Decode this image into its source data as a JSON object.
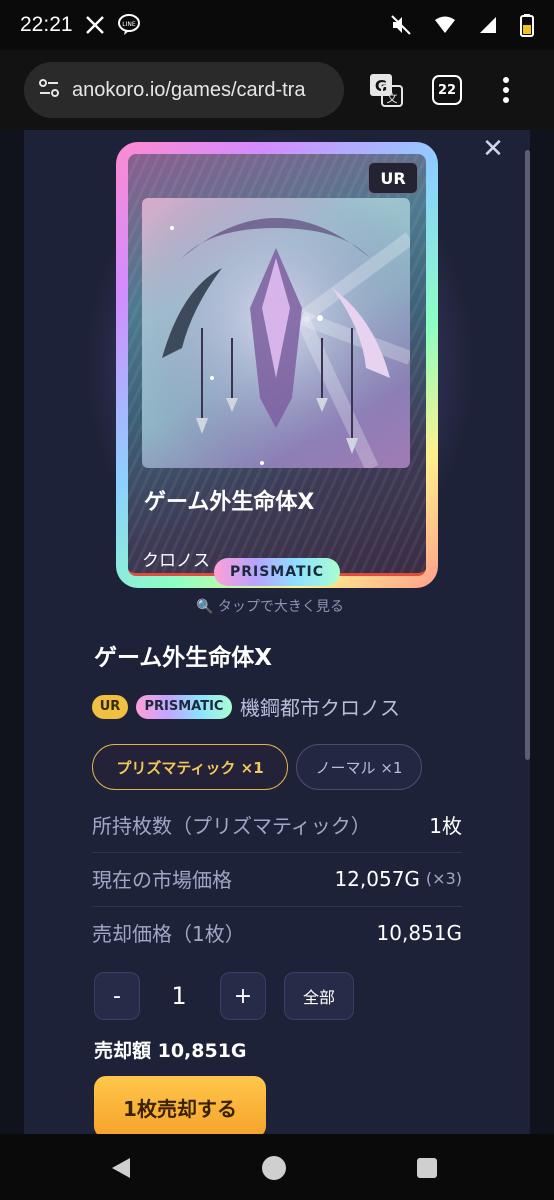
{
  "status_bar": {
    "time": "22:21",
    "icons": [
      "x-icon",
      "line-icon",
      "mute-icon",
      "wifi-icon",
      "signal-icon",
      "battery-icon"
    ]
  },
  "browser": {
    "url": "anokoro.io/games/card-tra",
    "tab_count": "22"
  },
  "card": {
    "rarity": "UR",
    "name": "ゲーム外生命体X",
    "place": "クロノス",
    "finish": "PRISMATIC",
    "tap_hint": "🔍 タップで大きく見る"
  },
  "detail": {
    "title": "ゲーム外生命体X",
    "badge_rarity": "UR",
    "badge_finish": "PRISMATIC",
    "place": "機鋼都市クロノス",
    "variants": [
      {
        "label": "プリズマティック ×1",
        "selected": true
      },
      {
        "label": "ノーマル ×1",
        "selected": false
      }
    ],
    "rows": [
      {
        "label": "所持枚数（プリズマティック）",
        "value": "1枚",
        "extra": ""
      },
      {
        "label": "現在の市場価格",
        "value": "12,057G",
        "extra": "(×3)"
      },
      {
        "label": "売却価格（1枚）",
        "value": "10,851G",
        "extra": ""
      }
    ],
    "quantity": "1",
    "minus": "-",
    "plus": "+",
    "all": "全部",
    "sell_amount": "売却額 10,851G",
    "sell_button": "1枚売却する"
  },
  "colors": {
    "accent": "#f5a22b",
    "modal_bg": "#1e2238",
    "gold": "#f3c85b"
  }
}
